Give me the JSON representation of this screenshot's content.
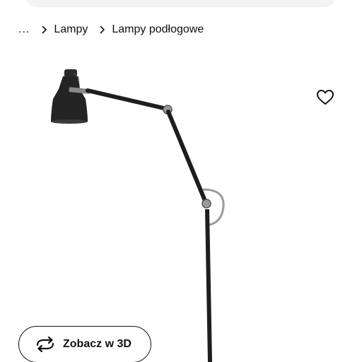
{
  "breadcrumb": {
    "ellipsis": "...",
    "items": [
      {
        "label": "Lampy"
      },
      {
        "label": "Lampy podłogowe"
      }
    ]
  },
  "product": {
    "image_icon": "floor-lamp-image",
    "favourite_icon": "heart-icon"
  },
  "actions": {
    "view_3d_label": "Zobacz w 3D",
    "view_3d_icon": "rotate-arrows-icon"
  }
}
